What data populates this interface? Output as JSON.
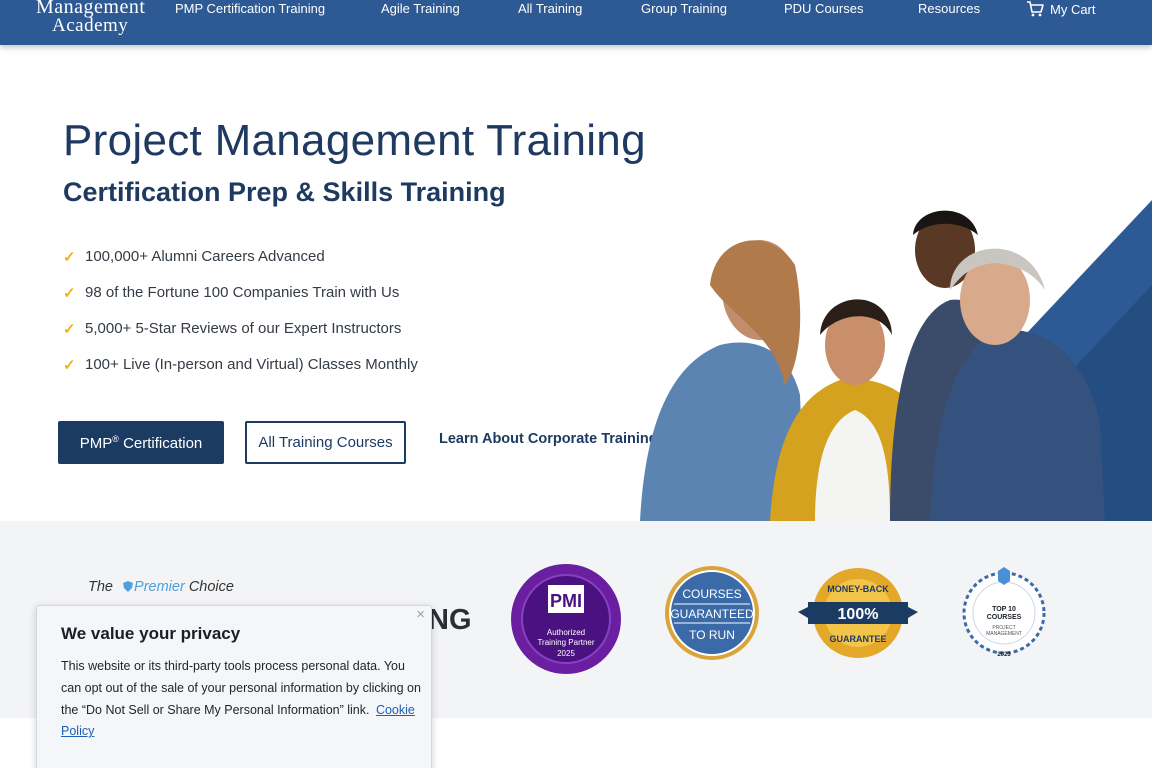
{
  "nav": {
    "logo_line1": "Management",
    "logo_line2": "Academy",
    "links": [
      "PMP Certification Training",
      "Agile Training",
      "All Training",
      "Group Training",
      "PDU Courses",
      "Resources"
    ],
    "cart_label": "My Cart"
  },
  "hero": {
    "title": "Project Management Training",
    "subtitle": "Certification Prep & Skills Training",
    "bullets": [
      "100,000+ Alumni Careers Advanced",
      "98 of the Fortune 100 Companies Train with Us",
      "5,000+ 5-Star Reviews of our Expert Instructors",
      "100+ Live (In-person and Virtual) Classes Monthly"
    ],
    "primary_button": "PMP",
    "primary_button_suffix": "Certification",
    "secondary_button": "All Training Courses",
    "corporate_link": "Learn About Corporate Training"
  },
  "premier": {
    "prefix": "The",
    "highlight": "Premier",
    "suffix": "Choice",
    "partial_heading": "NG"
  },
  "badges": {
    "pmi_label1": "Authorized",
    "pmi_label2": "Training Partner",
    "pmi_year": "2025",
    "courses_line1": "COURSES",
    "courses_line2": "GUARANTEED",
    "courses_line3": "TO RUN",
    "money_back_top": "MONEY-BACK",
    "money_back_pct": "100%",
    "money_back_bottom": "GUARANTEE",
    "top10_line1": "TOP 10",
    "top10_line2": "COURSES",
    "top10_line3": "PROJECT",
    "top10_line4": "MANAGEMENT",
    "top10_year": "2023"
  },
  "privacy": {
    "title": "We value your privacy",
    "body": "This website or its third-party tools process personal data. You can opt out of the sale of your personal information by clicking on the “Do Not Sell or Share My Personal Information” link.",
    "link": "Cookie Policy",
    "close": "×"
  },
  "colors": {
    "nav_bg": "#2d5a94",
    "primary": "#1c3b63",
    "check": "#f0b21b",
    "band_bg": "#f3f4f6"
  }
}
